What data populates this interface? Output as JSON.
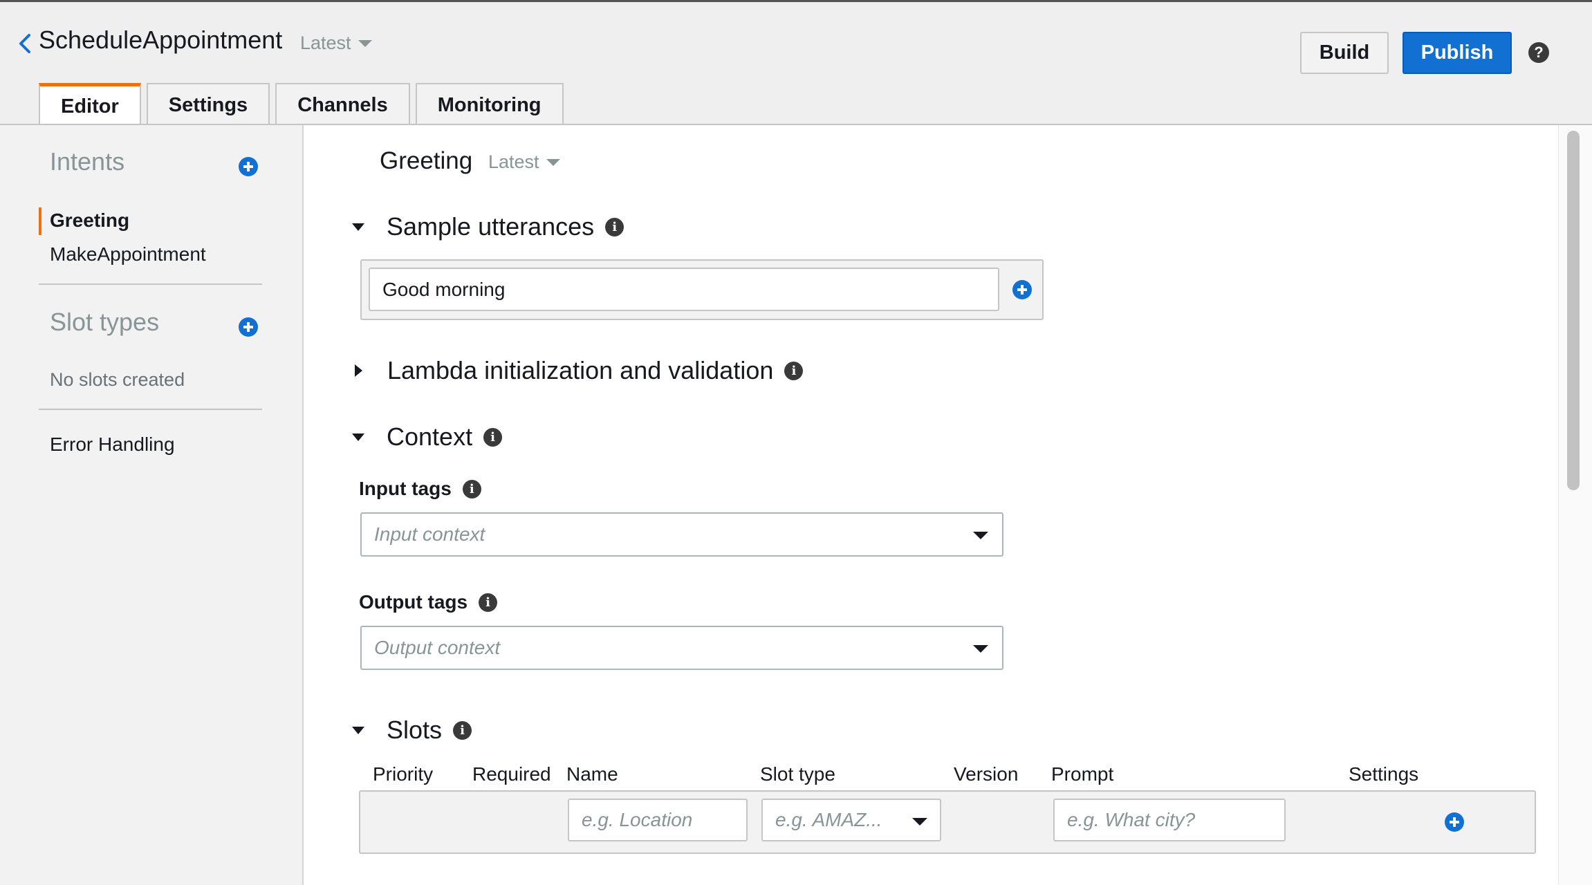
{
  "header": {
    "bot_name": "ScheduleAppointment",
    "version": "Latest",
    "build_label": "Build",
    "publish_label": "Publish",
    "help_glyph": "?"
  },
  "tabs": [
    {
      "label": "Editor",
      "active": true
    },
    {
      "label": "Settings",
      "active": false
    },
    {
      "label": "Channels",
      "active": false
    },
    {
      "label": "Monitoring",
      "active": false
    }
  ],
  "sidebar": {
    "intents_heading": "Intents",
    "intents": [
      {
        "label": "Greeting",
        "active": true
      },
      {
        "label": "MakeAppointment",
        "active": false
      }
    ],
    "slot_types_heading": "Slot types",
    "slot_types_empty": "No slots created",
    "error_handling_label": "Error Handling"
  },
  "main": {
    "intent_name": "Greeting",
    "intent_version": "Latest",
    "sections": {
      "sample_utterances": "Sample utterances",
      "lambda": "Lambda initialization and validation",
      "context": "Context",
      "slots": "Slots"
    },
    "utterance_value": "Good morning",
    "input_tags_label": "Input tags",
    "input_tags_placeholder": "Input context",
    "output_tags_label": "Output tags",
    "output_tags_placeholder": "Output context",
    "slot_columns": {
      "priority": "Priority",
      "required": "Required",
      "name": "Name",
      "slot_type": "Slot type",
      "version": "Version",
      "prompt": "Prompt",
      "settings": "Settings"
    },
    "slot_name_placeholder": "e.g. Location",
    "slot_type_placeholder": "e.g. AMAZ...",
    "slot_prompt_placeholder": "e.g. What city?"
  },
  "colors": {
    "primary": "#1370d3",
    "accent_orange": "#ec7211",
    "muted_text": "#879596"
  },
  "icons": {
    "back": "chevron-left-icon",
    "caret": "caret-down-icon",
    "help": "help-icon",
    "add": "plus-circle-icon",
    "info": "info-icon"
  }
}
